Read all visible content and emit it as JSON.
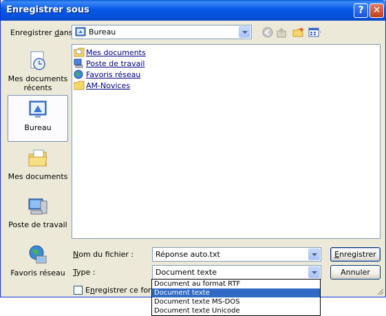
{
  "window": {
    "title": "Enregistrer sous"
  },
  "titlebar_buttons": {
    "help": "?",
    "close": "✕"
  },
  "save_in": {
    "label_pre": "Enregistrer ",
    "label_u": "d",
    "label_post": "ans :",
    "value": "Bureau"
  },
  "toolbar": [
    "back-icon",
    "up-folder-icon",
    "new-folder-icon",
    "views-menu-icon"
  ],
  "places": [
    {
      "label": "Mes documents récents",
      "icon": "recent-documents-icon"
    },
    {
      "label": "Bureau",
      "icon": "desktop-icon",
      "selected": true
    },
    {
      "label": "Mes documents",
      "icon": "my-documents-icon"
    },
    {
      "label": "Poste de travail",
      "icon": "my-computer-icon"
    },
    {
      "label": "Favoris réseau",
      "icon": "network-places-icon"
    }
  ],
  "files": [
    {
      "name": "Mes documents",
      "icon": "folder-documents-icon"
    },
    {
      "name": "Poste de travail",
      "icon": "computer-icon"
    },
    {
      "name": "Favoris réseau",
      "icon": "network-icon"
    },
    {
      "name": "AM-Novices",
      "icon": "folder-icon"
    }
  ],
  "filename": {
    "label_u": "N",
    "label_rest": "om du fichier :",
    "value": "Réponse auto.txt"
  },
  "filetype": {
    "label_u": "T",
    "label_rest": "ype :",
    "value": "Document texte"
  },
  "buttons": {
    "save_u": "E",
    "save_rest": "nregistrer",
    "cancel": "Annuler"
  },
  "checkbox": {
    "label_pre": "E",
    "label_u": "n",
    "label_post": "registrer ce format"
  },
  "type_options": [
    {
      "label": "Document au format RTF",
      "selected": false
    },
    {
      "label": "Document texte",
      "selected": true
    },
    {
      "label": "Document texte MS-DOS",
      "selected": false
    },
    {
      "label": "Document texte Unicode",
      "selected": false
    }
  ],
  "colors": {
    "titlebar": "#0558e4",
    "selection": "#316ac5",
    "dialog_bg": "#ece9d8"
  }
}
